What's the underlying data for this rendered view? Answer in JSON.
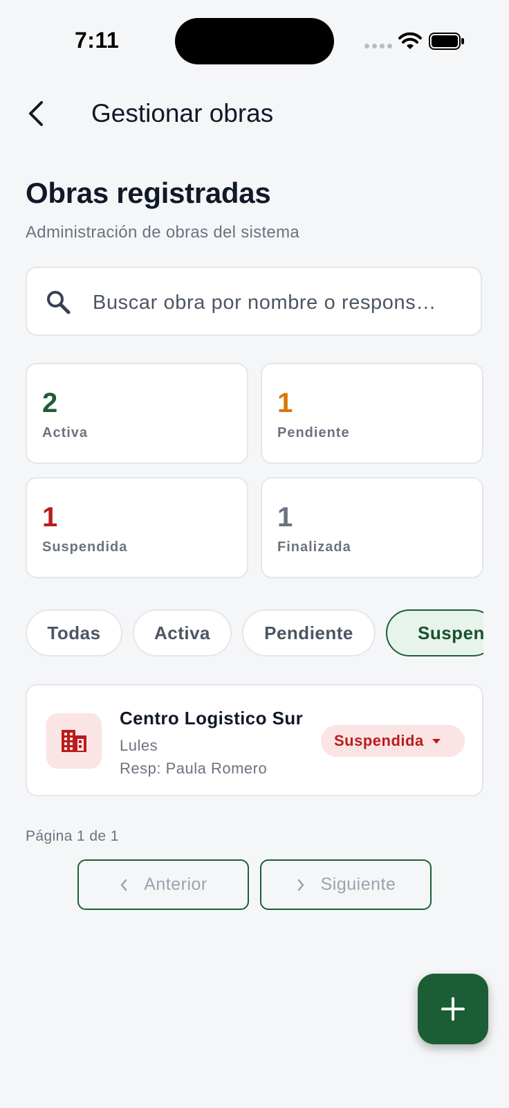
{
  "status_bar": {
    "time": "7:11"
  },
  "header": {
    "title": "Gestionar obras"
  },
  "page": {
    "title": "Obras registradas",
    "subtitle": "Administración de obras del sistema"
  },
  "search": {
    "placeholder": "Buscar obra por nombre o respons…"
  },
  "stats": [
    {
      "count": "2",
      "label": "Activa",
      "color": "#1b5e35"
    },
    {
      "count": "1",
      "label": "Pendiente",
      "color": "#d97706"
    },
    {
      "count": "1",
      "label": "Suspendida",
      "color": "#b91c1c"
    },
    {
      "count": "1",
      "label": "Finalizada",
      "color": "#6b7280"
    }
  ],
  "filters": [
    {
      "label": "Todas",
      "selected": false
    },
    {
      "label": "Activa",
      "selected": false
    },
    {
      "label": "Pendiente",
      "selected": false
    },
    {
      "label": "Suspendida",
      "selected": true
    }
  ],
  "obras": [
    {
      "name": "Centro Logistico Sur",
      "location": "Lules",
      "responsible": "Resp: Paula Romero",
      "status": "Suspendida",
      "icon": "building-icon"
    }
  ],
  "pagination": {
    "text": "Página 1 de 1",
    "prev_label": "Anterior",
    "next_label": "Siguiente"
  },
  "fab": {
    "icon": "plus-icon"
  },
  "colors": {
    "primary": "#1b5e35",
    "danger": "#b91c1c",
    "background": "#f5f6f8"
  }
}
